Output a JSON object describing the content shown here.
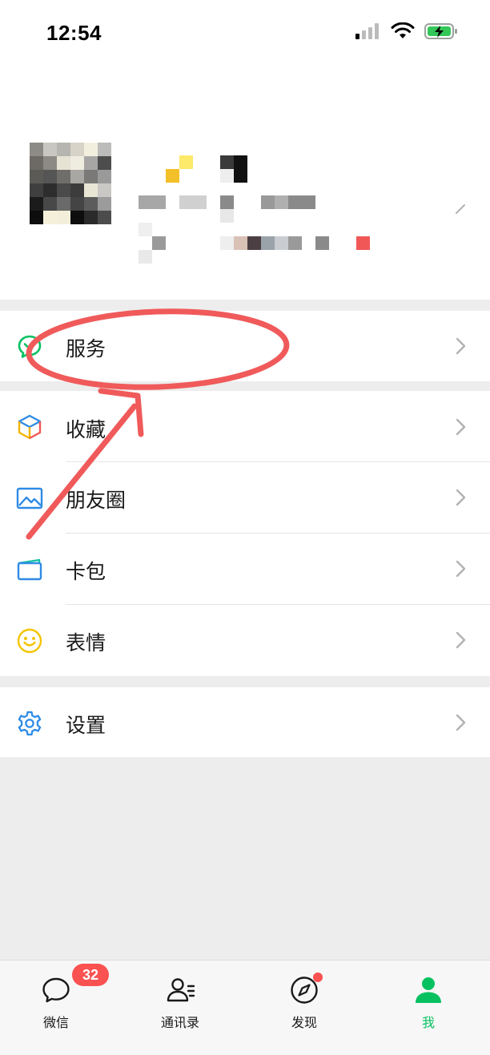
{
  "status_bar": {
    "time": "12:54"
  },
  "menu": {
    "service": {
      "label": "服务"
    },
    "favorites": {
      "label": "收藏"
    },
    "moments": {
      "label": "朋友圈"
    },
    "cards": {
      "label": "卡包"
    },
    "stickers": {
      "label": "表情"
    },
    "settings": {
      "label": "设置"
    }
  },
  "tabbar": {
    "chats": {
      "label": "微信",
      "badge": "32"
    },
    "contacts": {
      "label": "通讯录"
    },
    "discover": {
      "label": "发现"
    },
    "me": {
      "label": "我"
    }
  },
  "colors": {
    "accent": "#07c160",
    "badge": "#fa5151",
    "annotation": "#f05a5a"
  }
}
